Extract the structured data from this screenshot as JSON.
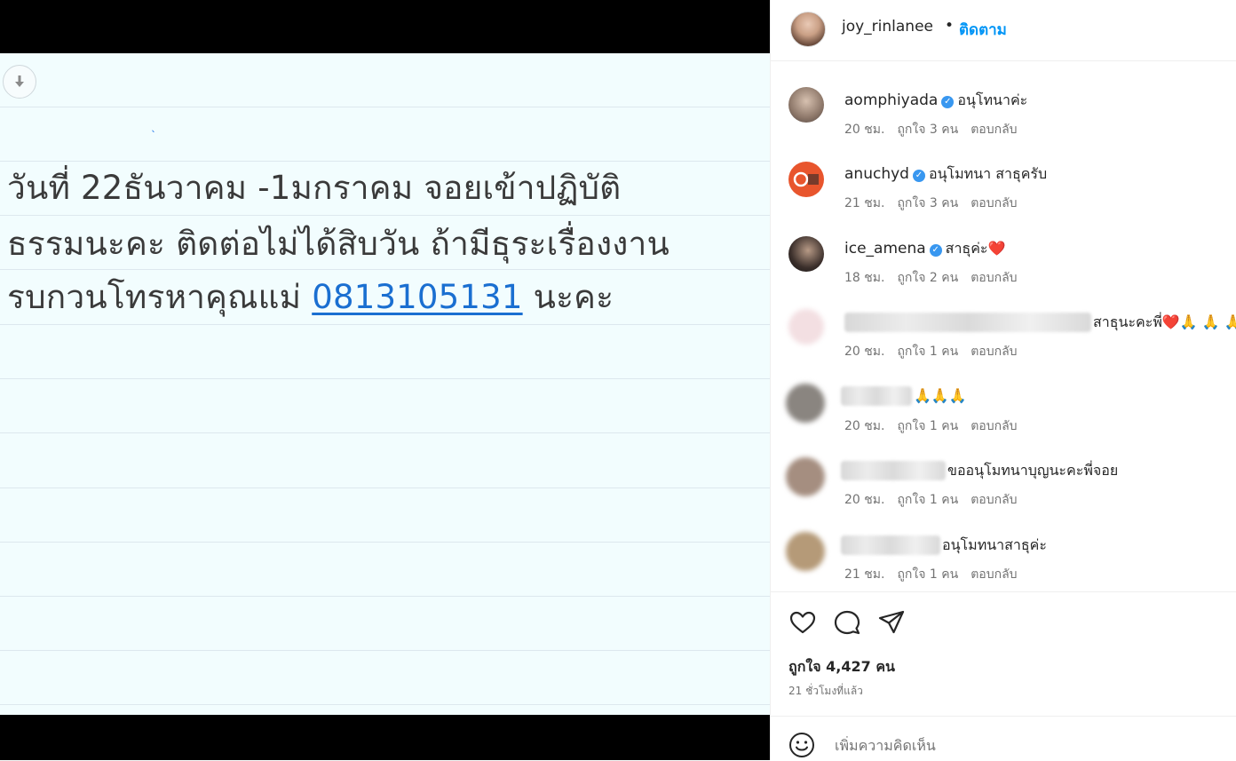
{
  "post": {
    "note_lines": [
      "วันที่ 22ธันวาคม -1มกราคม จอยเข้าปฏิบัติ",
      "ธรรมนะคะ ติดต่อไม่ได้สิบวัน ถ้ามีธุระเรื่องงาน",
      "รบกวนโทรหาคุณแม่"
    ],
    "phone": "0813105131",
    "after_phone": " นะคะ"
  },
  "header": {
    "username": "joy_rinlanee",
    "separator": "•",
    "follow_label": "ติดตาม"
  },
  "comments": [
    {
      "user": "aomphiyada",
      "verified": true,
      "text": "อนุโทนาค่ะ",
      "time": "20 ชม.",
      "likes": "ถูกใจ 3 คน",
      "reply": "ตอบกลับ"
    },
    {
      "user": "anuchyd",
      "verified": true,
      "text": "อนุโมทนา สาธุครับ",
      "time": "21 ชม.",
      "likes": "ถูกใจ 3 คน",
      "reply": "ตอบกลับ"
    },
    {
      "user": "ice_amena",
      "verified": true,
      "text": "สาธุค่ะ❤️",
      "time": "18 ชม.",
      "likes": "ถูกใจ 2 คน",
      "reply": "ตอบกลับ"
    },
    {
      "user": "",
      "verified": false,
      "text": "สาธุนะคะพี่❤️🙏 🙏 🙏",
      "time": "20 ชม.",
      "likes": "ถูกใจ 1 คน",
      "reply": "ตอบกลับ"
    },
    {
      "user": "",
      "verified": false,
      "text": "🙏🙏🙏",
      "time": "20 ชม.",
      "likes": "ถูกใจ 1 คน",
      "reply": "ตอบกลับ"
    },
    {
      "user": "",
      "verified": false,
      "text": "ขออนุโมทนาบุญนะคะพี่จอย",
      "time": "20 ชม.",
      "likes": "ถูกใจ 1 คน",
      "reply": "ตอบกลับ"
    },
    {
      "user": "",
      "verified": false,
      "text": "อนุโมทนาสาธุค่ะ",
      "time": "21 ชม.",
      "likes": "ถูกใจ 1 คน",
      "reply": "ตอบกลับ"
    }
  ],
  "actions": {
    "likes_label": "ถูกใจ 4,427 คน",
    "posted_ago": "21 ชั่วโมงที่แล้ว"
  },
  "composer": {
    "placeholder": "เพิ่มความคิดเห็น"
  },
  "icons": {
    "download": "download-arrow-icon",
    "like": "heart-icon",
    "comment": "speech-bubble-icon",
    "share": "paper-plane-icon",
    "emoji": "smiley-icon",
    "verified": "verified-badge-icon"
  },
  "colors": {
    "link_blue": "#0095f6",
    "phone_blue": "#1a6fd1",
    "note_bg": "#f2fdfe",
    "verified": "#3897f0"
  }
}
